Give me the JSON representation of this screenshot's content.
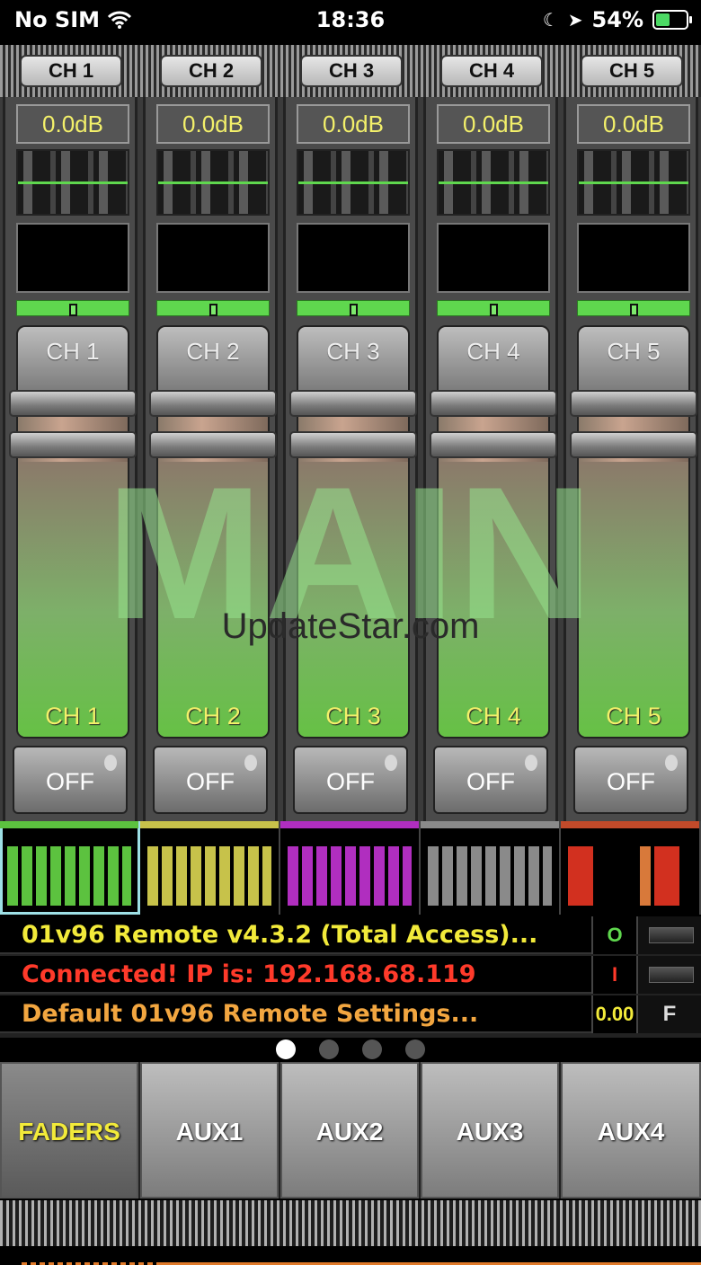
{
  "status_bar": {
    "carrier": "No SIM",
    "time": "18:36",
    "battery": "54%",
    "battery_fraction": 0.54
  },
  "channel_tabs": [
    "CH 1",
    "CH 2",
    "CH 3",
    "CH 4",
    "CH 5"
  ],
  "channels": [
    {
      "db": "0.0dB",
      "top_label": "CH 1",
      "bottom_label": "CH 1",
      "mute": "OFF"
    },
    {
      "db": "0.0dB",
      "top_label": "CH 2",
      "bottom_label": "CH 2",
      "mute": "OFF"
    },
    {
      "db": "0.0dB",
      "top_label": "CH 3",
      "bottom_label": "CH 3",
      "mute": "OFF"
    },
    {
      "db": "0.0dB",
      "top_label": "CH 4",
      "bottom_label": "CH 4",
      "mute": "OFF"
    },
    {
      "db": "0.0dB",
      "top_label": "CH 5",
      "bottom_label": "CH 5",
      "mute": "OFF"
    }
  ],
  "overlay": {
    "main": "MAIN",
    "site": "UpdateStar.com"
  },
  "bank_colors": [
    "#5cc23f",
    "#c7c24a",
    "#b02ebf",
    "#8a8a8a",
    "#c24a2a"
  ],
  "info": {
    "line1": "01v96 Remote v4.3.2 (Total Access)...",
    "line2": "Connected! IP is: 192.168.68.119",
    "line3": "Default 01v96 Remote Settings...",
    "indicator1": "O",
    "indicator2": "I",
    "level": "0.00",
    "flag": "F",
    "color1": "#f2ea3a",
    "color2": "#ff3a2a",
    "color3": "#f2a640"
  },
  "page_indicator": {
    "count": 4,
    "active": 0
  },
  "bottom_tabs": [
    "FADERS",
    "AUX1",
    "AUX2",
    "AUX3",
    "AUX4"
  ]
}
